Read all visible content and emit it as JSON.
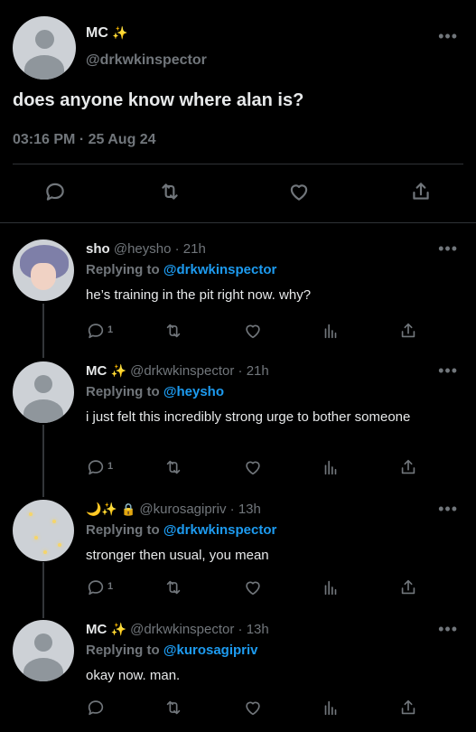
{
  "main_tweet": {
    "name": "MC",
    "name_emoji": "✨",
    "handle": "@drkwkinspector",
    "text": "does anyone know where alan is?",
    "timestamp": "03:16 PM · 25 Aug 24",
    "actions": [
      "reply-icon",
      "retweet-icon",
      "like-icon",
      "share-icon"
    ]
  },
  "replies": [
    {
      "name": "sho",
      "handle": "@heysho",
      "time": "· 21h",
      "replying_prefix": "Replying to",
      "replying_to": "@drkwkinspector",
      "text": "he’s training in the pit right now. why?",
      "reply_count": "1"
    },
    {
      "name": "MC",
      "name_emoji": "✨",
      "handle": "@drkwkinspector",
      "time": "· 21h",
      "replying_prefix": "Replying to",
      "replying_to": "@heysho",
      "text": "i just felt this incredibly strong urge to bother someone",
      "reply_count": "1"
    },
    {
      "name_emoji": "🌙✨",
      "lock": "🔒",
      "handle": "@kurosagipriv",
      "time": "· 13h",
      "replying_prefix": "Replying to",
      "replying_to": "@drkwkinspector",
      "text": "stronger then usual, you mean",
      "reply_count": "1"
    },
    {
      "name": "MC",
      "name_emoji": "✨",
      "handle": "@drkwkinspector",
      "time": "· 13h",
      "replying_prefix": "Replying to",
      "replying_to": "@kurosagipriv",
      "text": "okay now. man.",
      "reply_count": ""
    }
  ],
  "more_label": "•••",
  "colors": {
    "background": "#000000",
    "text": "#e7e9ea",
    "muted": "#71767b",
    "link": "#1d9bf0",
    "divider": "#2f3336"
  }
}
